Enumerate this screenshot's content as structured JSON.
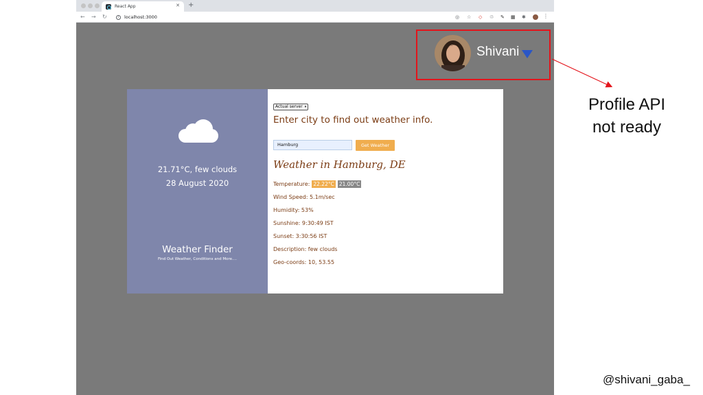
{
  "browser": {
    "tab_title": "React App",
    "tab_close": "✕",
    "new_tab": "+",
    "nav": {
      "back": "←",
      "forward": "→",
      "reload": "↻"
    },
    "url": "localhost:3000"
  },
  "profile": {
    "name": "Shivani"
  },
  "weather_app": {
    "sidebar": {
      "summary": "21.71°C, few clouds",
      "date": "28 August 2020",
      "title": "Weather Finder",
      "tagline": "Find Out Weather, Conditions and More...."
    },
    "server_select": {
      "selected": "Actual server"
    },
    "prompt": "Enter city to find out weather info.",
    "city_input": {
      "value": "Hamburg"
    },
    "get_button": "Get Weather",
    "result_title": "Weather in Hamburg, DE",
    "details": {
      "temperature_label": "Temperature:",
      "temperature_max": "22.22°C",
      "temperature_min": "21.00°C",
      "wind": "Wind Speed: 5.1m/sec",
      "humidity": "Humidity: 53%",
      "sunshine": "Sunshine: 9:30:49 IST",
      "sunset": "Sunset: 3:30:56 IST",
      "description": "Description: few clouds",
      "geo": "Geo-coords: 10, 53.55"
    }
  },
  "annotation": {
    "line1": "Profile API",
    "line2": "not ready",
    "handle": "@shivani_gaba_"
  },
  "colors": {
    "highlight_border": "#e4141b",
    "sidebar_bg": "#7f86ab",
    "text_brown": "#7b3c14",
    "button_orange": "#f0ad4e",
    "caret_blue": "#2a56c6"
  }
}
